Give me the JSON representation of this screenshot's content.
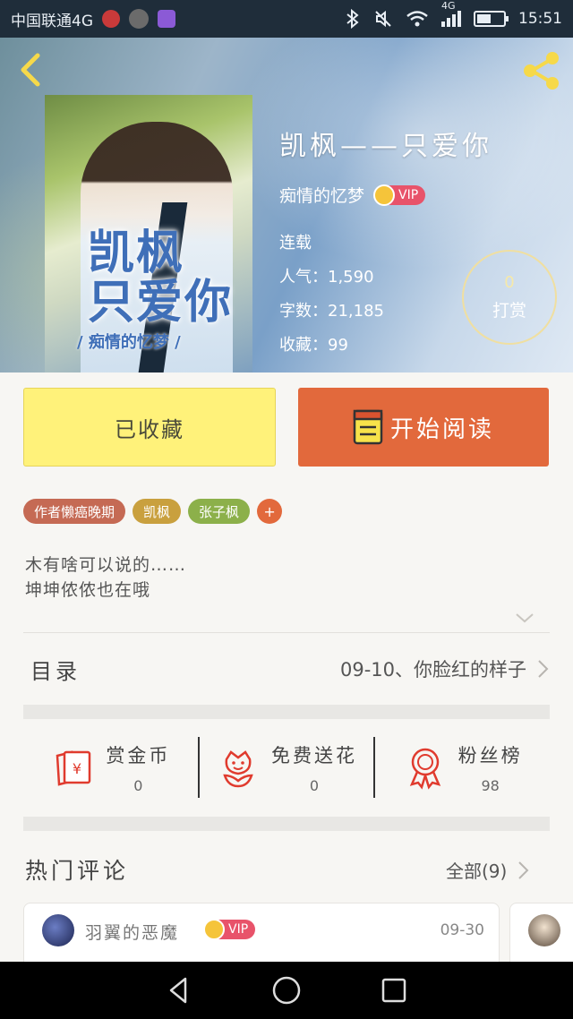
{
  "status_bar": {
    "carrier": "中国联通4G",
    "time": "15:51",
    "network": "4G",
    "battery_level": 0.55
  },
  "book": {
    "title": "凯枫——只爱你",
    "author": "痴情的忆梦",
    "author_badge": "VIP",
    "status": "连载",
    "popularity_label": "人气：",
    "popularity": "1,590",
    "word_count_label": "字数：",
    "word_count": "21,185",
    "favorites_label": "收藏：",
    "favorites": "99",
    "cover_title": "凯枫\n只爱你",
    "cover_subtitle": "/ 痴情的忆梦 /"
  },
  "reward": {
    "count": "0",
    "label": "打赏"
  },
  "actions": {
    "collected_label": "已收藏",
    "read_label": "开始阅读"
  },
  "tags": [
    {
      "label": "作者懒癌晚期",
      "color": "#c56a54"
    },
    {
      "label": "凯枫",
      "color": "#c9a03e"
    },
    {
      "label": "张子枫",
      "color": "#8cb04a"
    }
  ],
  "tag_add": "+",
  "intro": {
    "line1": "木有啥可以说的……",
    "line2": "坤坤侬侬也在哦"
  },
  "toc": {
    "label": "目录",
    "latest_chapter": "09-10、你脸红的样子"
  },
  "stats": [
    {
      "name": "赏金币",
      "value": "0",
      "icon": "red-envelope-icon"
    },
    {
      "name": "免费送花",
      "value": "0",
      "icon": "flower-icon"
    },
    {
      "name": "粉丝榜",
      "value": "98",
      "icon": "medal-icon"
    }
  ],
  "comments_section": {
    "title": "热门评论",
    "all_label": "全部(9)"
  },
  "comments": [
    {
      "user": "羽翼的恶魔",
      "badge": "VIP",
      "date": "09-30"
    }
  ],
  "colors": {
    "accent_orange": "#e2693c",
    "collected_yellow": "#fff27a",
    "vip_red": "#e8536a",
    "icon_red": "#e03b2e"
  }
}
